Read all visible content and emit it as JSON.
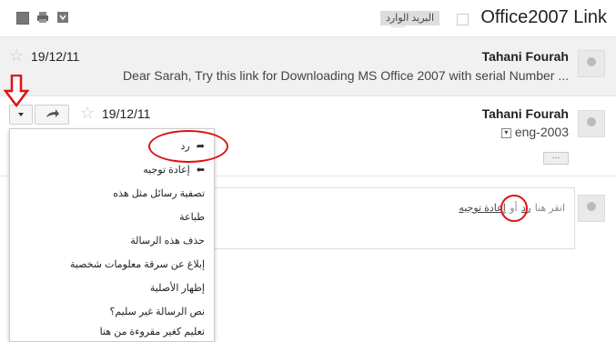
{
  "header": {
    "title": "Office2007 Link",
    "label_chip": "البريد الوارد",
    "label_remove": "x"
  },
  "messages": [
    {
      "sender": "Tahani Fourah",
      "date": "19/12/11",
      "snippet": "Dear Sarah, Try this link for Downloading MS Office 2007 with serial Number ..."
    },
    {
      "sender": "Tahani Fourah",
      "date": "19/12/11",
      "to": "eng-2003"
    }
  ],
  "reply_box": {
    "prompt": "انقر هنا",
    "reply_link": "رد",
    "or_text": "أو",
    "forward_link": "إعادة توجيه"
  },
  "dropdown": {
    "items": [
      {
        "label": "رد",
        "icon": "reply-icon"
      },
      {
        "label": "إعادة توجيه",
        "icon": "forward-icon"
      },
      {
        "label": "تصفية رسائل مثل هذه"
      },
      {
        "label": "طباعة"
      },
      {
        "label": "حذف هذه الرسالة"
      },
      {
        "label": "إبلاغ عن سرقة معلومات شخصية"
      },
      {
        "label": "إظهار الأصلية"
      },
      {
        "label": "نص الرسالة غير سليم؟"
      },
      {
        "label": "تعليم كغير مقروءة من هنا"
      }
    ]
  },
  "more_dots": "...",
  "colors": {
    "annotation": "#e01010",
    "background": "#ffffff",
    "collapsed_row": "#f1f1f1"
  }
}
